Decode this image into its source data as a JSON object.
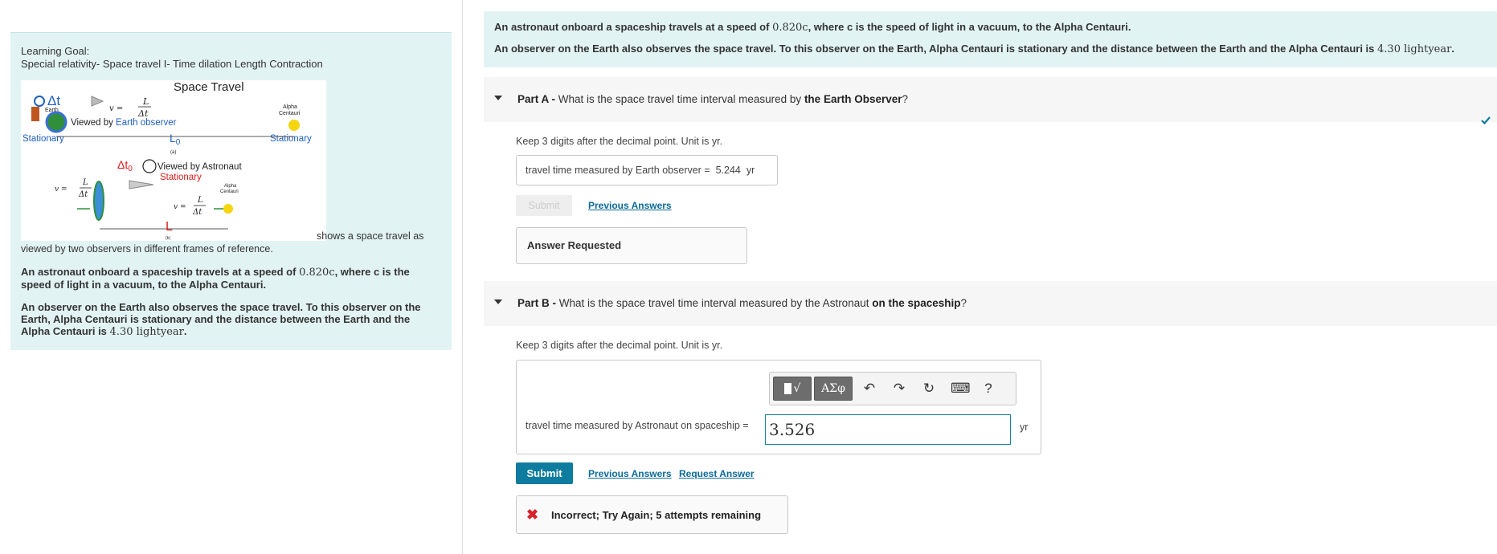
{
  "left": {
    "heading": "Learning Goal:",
    "subheading": "Special relativity- Space travel I- Time dilation Length Contraction",
    "caption_a": "shows a space travel as",
    "caption_b": "viewed by two observers in different frames of reference.",
    "p1": "An astronaut onboard a spaceship travels at a speed of",
    "p1_speed": "0.820c",
    "p1_rest": ", where c is the speed of light in a vacuum, to the Alpha Centauri.",
    "p2": "An observer on the Earth also observes the space travel. To this observer on the Earth, Alpha Centauri is stationary and the distance between the Earth and the Alpha Centauri is",
    "p2_value": "4.30 lightyear",
    "p2_end": "."
  },
  "figure": {
    "title": "Space Travel",
    "earth_label": "Earth",
    "alpha_label_1": "Alpha",
    "alpha_label_2": "Centauri",
    "viewed_earth_prefix": "Viewed by ",
    "viewed_earth_suffix": "Earth observer",
    "stationary": "Stationary",
    "label_a": "(a)",
    "label_b": "(b)",
    "viewed_astronaut": "Viewed by Astronaut",
    "delta_t": "Δt",
    "delta_t0": "Δt",
    "sub0": "0",
    "l0": "L",
    "l": "L",
    "v_eq": "v =",
    "colors": {
      "blue": "#1f5fc2",
      "red": "#e01b1b",
      "dark": "#222222"
    }
  },
  "intro": {
    "p1": "An astronaut onboard a spaceship travels at a speed of",
    "p1_speed": "0.820c",
    "p1_rest": ", where c is the speed of light in a vacuum, to the Alpha Centauri.",
    "p2": "An observer on the Earth also observes the space travel. To this observer on the Earth, Alpha Centauri is stationary and the distance between the Earth and the Alpha Centauri is",
    "p2_value": "4.30 lightyear",
    "p2_end": "."
  },
  "partA": {
    "label": "Part A -",
    "question": "What is the space travel time interval measured by",
    "emphasis": "the Earth Observer",
    "q_end": "?",
    "hint": "Keep 3 digits after the decimal point. Unit is yr.",
    "answer_label": "travel time measured by Earth observer =",
    "answer_value": "5.244",
    "answer_unit": "yr",
    "submit_label": "Submit",
    "previous_answers": "Previous Answers",
    "answer_requested": "Answer Requested"
  },
  "partB": {
    "label": "Part B -",
    "question": "What is the space travel time interval measured by the Astronaut",
    "emphasis": "on the spaceship",
    "q_end": "?",
    "hint": "Keep 3 digits after the decimal point. Unit is yr.",
    "toolbar": {
      "templates": "√",
      "symbols": "ΑΣφ",
      "undo": "↶",
      "redo": "↷",
      "reset": "↻",
      "keyboard": "⌨",
      "help": "?"
    },
    "input_label": "travel time measured by Astronaut on spaceship =",
    "input_value": "3.526",
    "unit": "yr",
    "submit_label": "Submit",
    "previous_answers": "Previous Answers",
    "request_answer": "Request Answer",
    "feedback": "Incorrect; Try Again; 5 attempts remaining"
  },
  "icons": {
    "caret": "caret-down-icon",
    "check": "checkmark-icon",
    "error": "x-mark-icon"
  }
}
